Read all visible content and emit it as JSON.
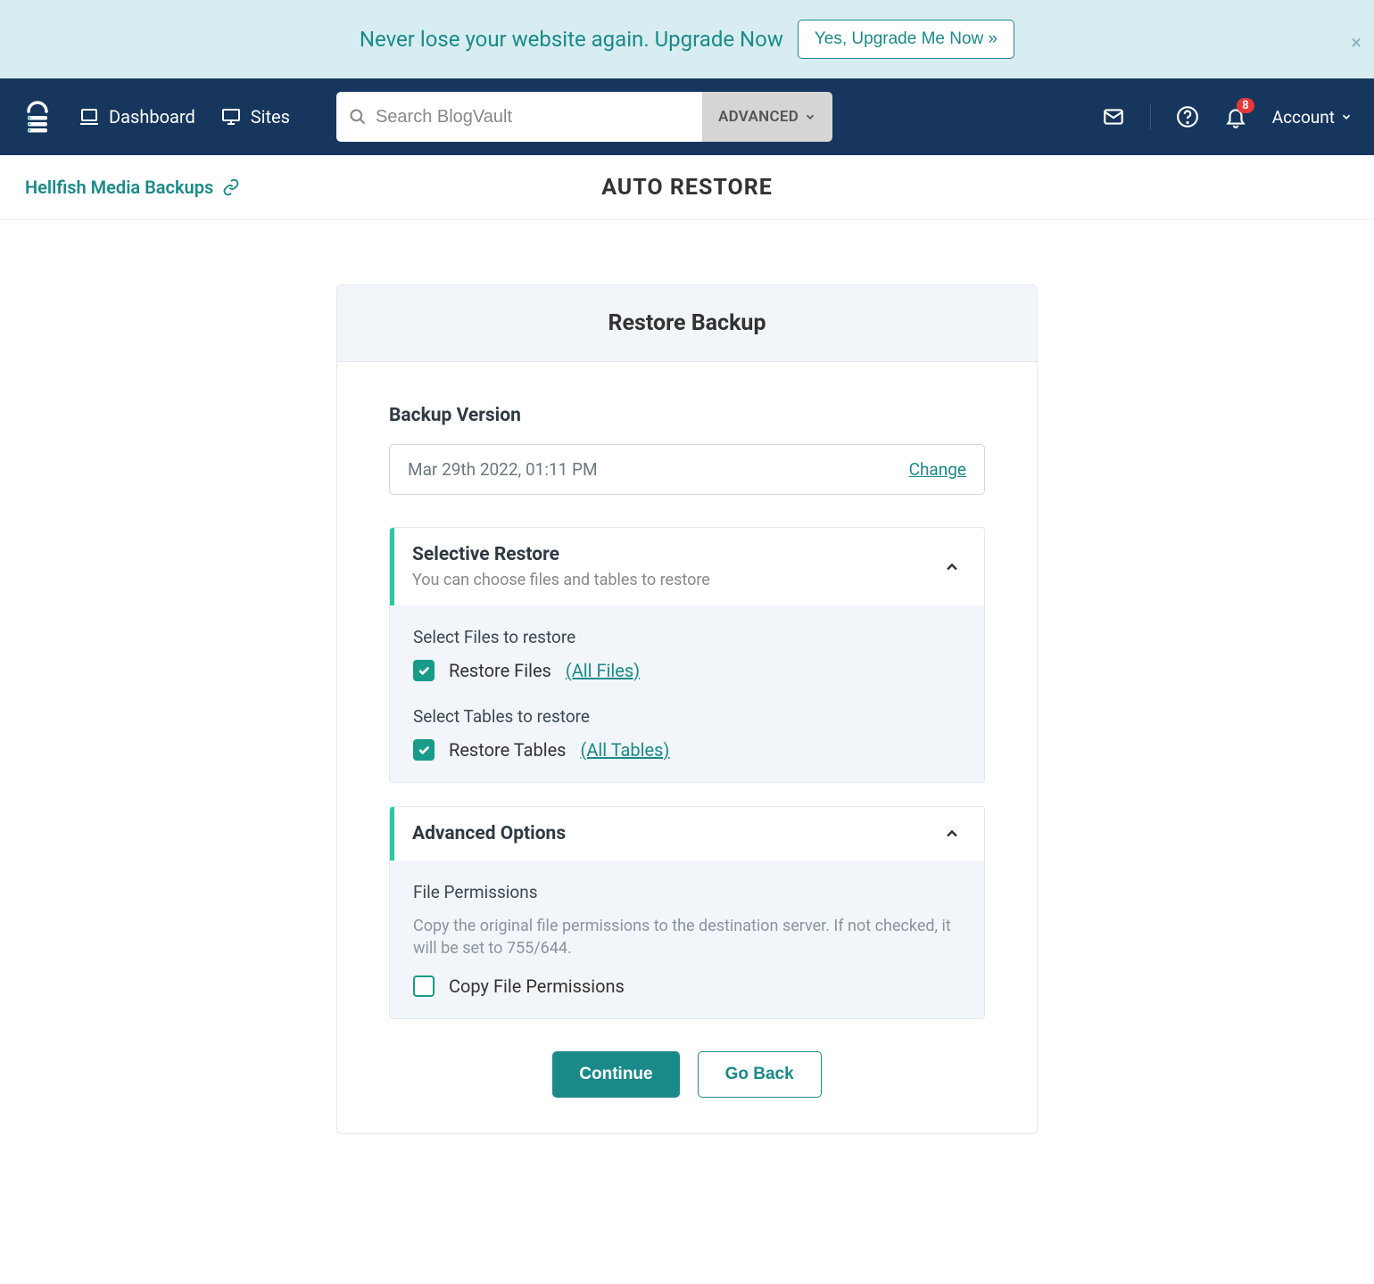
{
  "promo": {
    "text": "Never lose your website again. Upgrade Now",
    "button": "Yes, Upgrade Me Now »"
  },
  "nav": {
    "dashboard": "Dashboard",
    "sites": "Sites",
    "search_placeholder": "Search BlogVault",
    "advanced": "ADVANCED",
    "badge_count": "8",
    "account": "Account"
  },
  "subheader": {
    "breadcrumb": "Hellfish Media Backups",
    "title": "AUTO RESTORE"
  },
  "card": {
    "title": "Restore Backup",
    "version_label": "Backup Version",
    "version_value": "Mar 29th 2022, 01:11 PM",
    "change": "Change"
  },
  "selective": {
    "title": "Selective Restore",
    "sub": "You can choose files and tables to restore",
    "files_label": "Select Files to restore",
    "restore_files": "Restore Files",
    "all_files": "(All Files)",
    "tables_label": "Select Tables to restore",
    "restore_tables": "Restore Tables",
    "all_tables": "(All Tables)"
  },
  "advanced": {
    "title": "Advanced Options",
    "perm_title": "File Permissions",
    "perm_desc": "Copy the original file permissions to the destination server. If not checked, it will be set to 755/644.",
    "copy_perm": "Copy File Permissions"
  },
  "actions": {
    "continue": "Continue",
    "goback": "Go Back"
  }
}
